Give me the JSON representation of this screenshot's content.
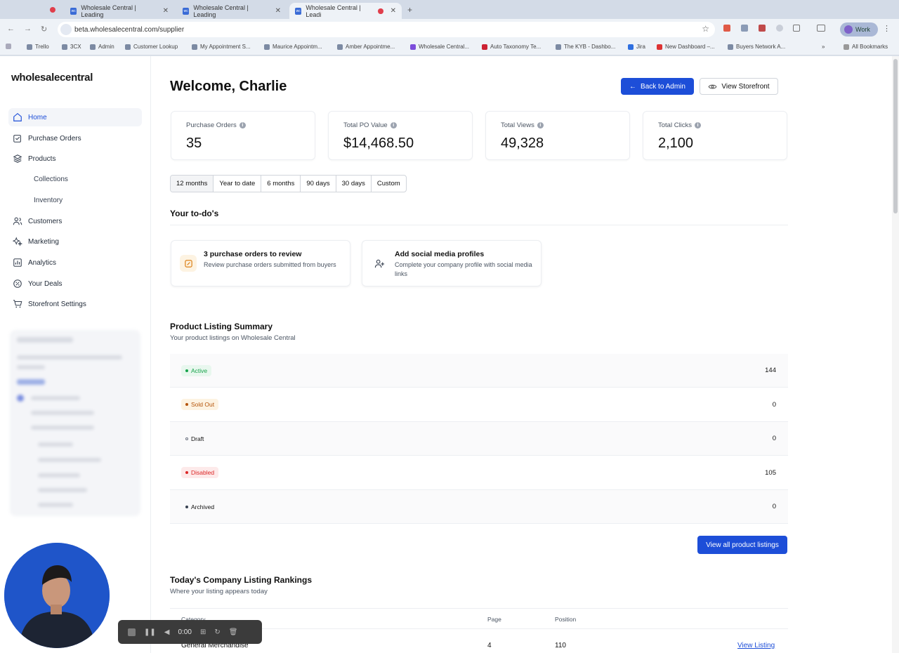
{
  "browser": {
    "tabs": [
      {
        "title": "Wholesale Central | Leading",
        "active": false
      },
      {
        "title": "Wholesale Central | Leading",
        "active": false
      },
      {
        "title": "Wholesale Central | Leadi",
        "active": true
      }
    ],
    "new_tab_label": "+",
    "url": "beta.wholesalecentral.com/supplier",
    "profile_label": "Work",
    "bookmarks": [
      "Trello",
      "3CX",
      "Admin",
      "Customer Lookup",
      "My Appointment S...",
      "Maurice Appointm...",
      "Amber Appointme...",
      "Wholesale Central...",
      "Auto Taxonomy Te...",
      "The KYB - Dashbo...",
      "Jira",
      "New Dashboard –...",
      "Buyers Network A..."
    ],
    "all_bookmarks_label": "All Bookmarks"
  },
  "sidebar": {
    "logo": "wholesalecentral",
    "items": [
      {
        "label": "Home",
        "icon": "home-icon",
        "active": true
      },
      {
        "label": "Purchase Orders",
        "icon": "purchase-orders-icon"
      },
      {
        "label": "Products",
        "icon": "layers-icon"
      },
      {
        "label": "Collections",
        "sub": true
      },
      {
        "label": "Inventory",
        "sub": true
      },
      {
        "label": "Customers",
        "icon": "users-icon"
      },
      {
        "label": "Marketing",
        "icon": "sparkle-icon"
      },
      {
        "label": "Analytics",
        "icon": "chart-icon"
      },
      {
        "label": "Your Deals",
        "icon": "percent-icon"
      },
      {
        "label": "Storefront Settings",
        "icon": "cart-icon"
      }
    ]
  },
  "header": {
    "welcome": "Welcome, Charlie",
    "back_button": "Back to Admin",
    "storefront_button": "View Storefront"
  },
  "kpis": [
    {
      "label": "Purchase Orders",
      "value": "35"
    },
    {
      "label": "Total PO Value",
      "value": "$14,468.50"
    },
    {
      "label": "Total Views",
      "value": "49,328"
    },
    {
      "label": "Total Clicks",
      "value": "2,100"
    }
  ],
  "ranges": [
    "12 months",
    "Year to date",
    "6 months",
    "90 days",
    "30 days",
    "Custom"
  ],
  "todos": {
    "title": "Your to-do's",
    "items": [
      {
        "title": "3 purchase orders to review",
        "desc": "Review purchase orders submitted from buyers"
      },
      {
        "title": "Add social media profiles",
        "desc": "Complete your company profile with social media links"
      }
    ]
  },
  "listing": {
    "title": "Product Listing Summary",
    "subtitle": "Your product listings on Wholesale Central",
    "rows": [
      {
        "status": "Active",
        "count": "144",
        "color": "#16a34a",
        "bg": "#e8f7ee"
      },
      {
        "status": "Sold Out",
        "count": "0",
        "color": "#b45309",
        "bg": "#fdf3e2"
      },
      {
        "status": "Draft",
        "count": "0",
        "color": "#6b7280",
        "bg": "transparent"
      },
      {
        "status": "Disabled",
        "count": "105",
        "color": "#dc2626",
        "bg": "#fdeaea"
      },
      {
        "status": "Archived",
        "count": "0",
        "color": "#374151",
        "bg": "transparent"
      }
    ],
    "view_all": "View all product listings"
  },
  "rankings": {
    "title": "Today's Company Listing Rankings",
    "subtitle": "Where your listing appears today",
    "headers": [
      "Category",
      "Page",
      "Position"
    ],
    "rows": [
      {
        "category": "General Merchandise",
        "page": "4",
        "position": "110",
        "link": "View Listing"
      }
    ]
  },
  "recorder": {
    "time": "0:00"
  }
}
